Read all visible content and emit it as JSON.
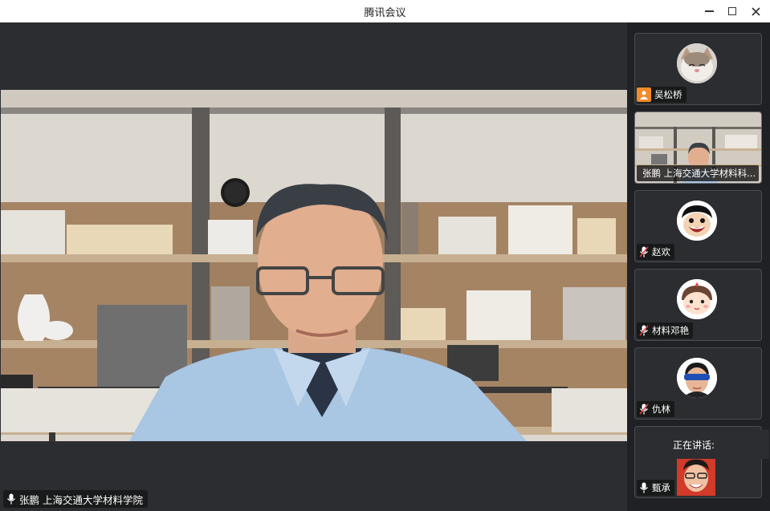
{
  "window": {
    "title": "腾讯会议"
  },
  "main": {
    "speaker_label": "张鹏 上海交通大学材料学院"
  },
  "participants": [
    {
      "name": "吴松桥",
      "status": "user-icon"
    },
    {
      "name": "张鹏 上海交通大学材料科...",
      "status": "mic-on"
    },
    {
      "name": "赵欢",
      "status": "mic-muted"
    },
    {
      "name": "材料邓艳",
      "status": "mic-muted"
    },
    {
      "name": "仇林",
      "status": "mic-muted"
    },
    {
      "name": "甄承",
      "status": "mic-on"
    }
  ],
  "speaking": {
    "label": "正在讲话:"
  },
  "colors": {
    "accent_user": "#f08c2b",
    "muted_red": "#e04040",
    "sidebar_bg": "#1f2124"
  }
}
